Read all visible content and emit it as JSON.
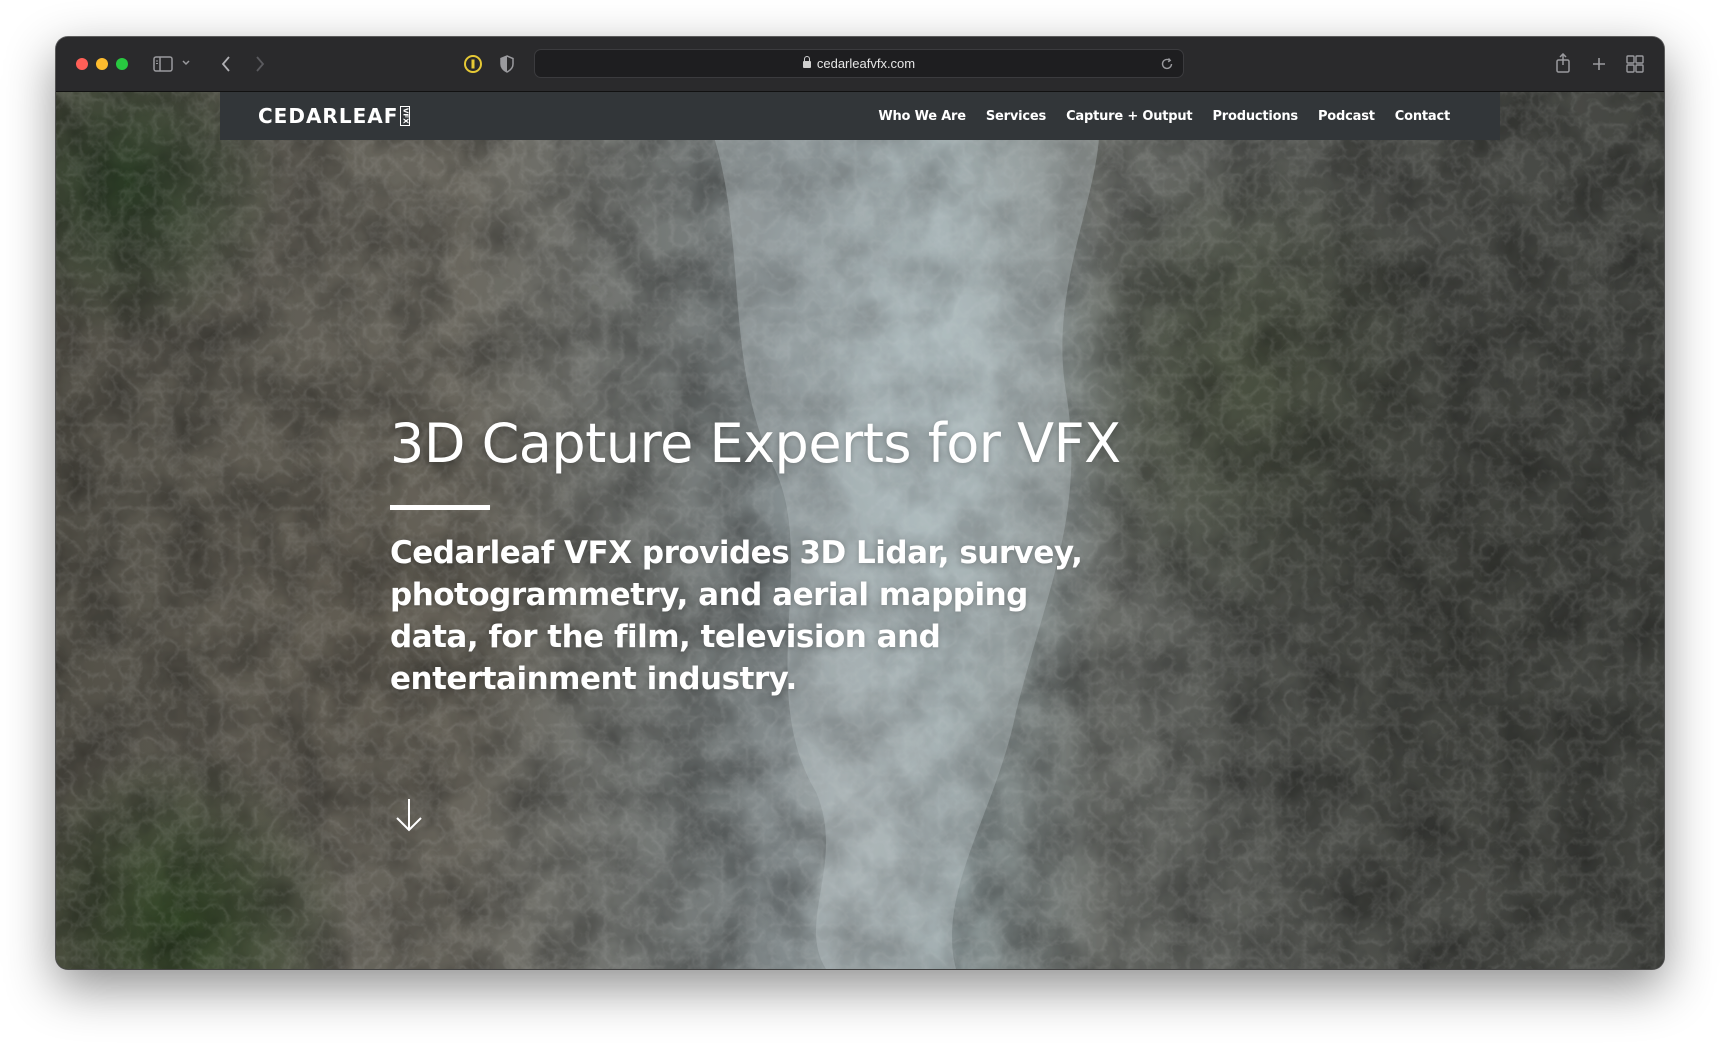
{
  "browser": {
    "url": "cedarleafvfx.com",
    "icons": [
      "sidebar-icon",
      "chevron-down-icon",
      "back-icon",
      "forward-icon",
      "password-manager-icon",
      "privacy-shield-icon",
      "lock-icon",
      "reload-icon",
      "share-icon",
      "new-tab-icon",
      "tab-overview-icon"
    ]
  },
  "site": {
    "logo_text": "CEDARLEAF",
    "logo_tag": "VFX",
    "nav": [
      {
        "label": "Who We Are"
      },
      {
        "label": "Services"
      },
      {
        "label": "Capture + Output"
      },
      {
        "label": "Productions"
      },
      {
        "label": "Podcast"
      },
      {
        "label": "Contact"
      }
    ],
    "hero": {
      "title": "3D Capture Experts for VFX",
      "subtitle": "Cedarleaf VFX provides 3D Lidar, survey, photogrammetry, and aerial mapping data, for the film, television and entertainment industry."
    },
    "scroll_icon": "arrow-down-icon"
  },
  "colors": {
    "nav_background": "#323639",
    "toolbar_background": "#2a2a2c",
    "text": "#ffffff"
  }
}
